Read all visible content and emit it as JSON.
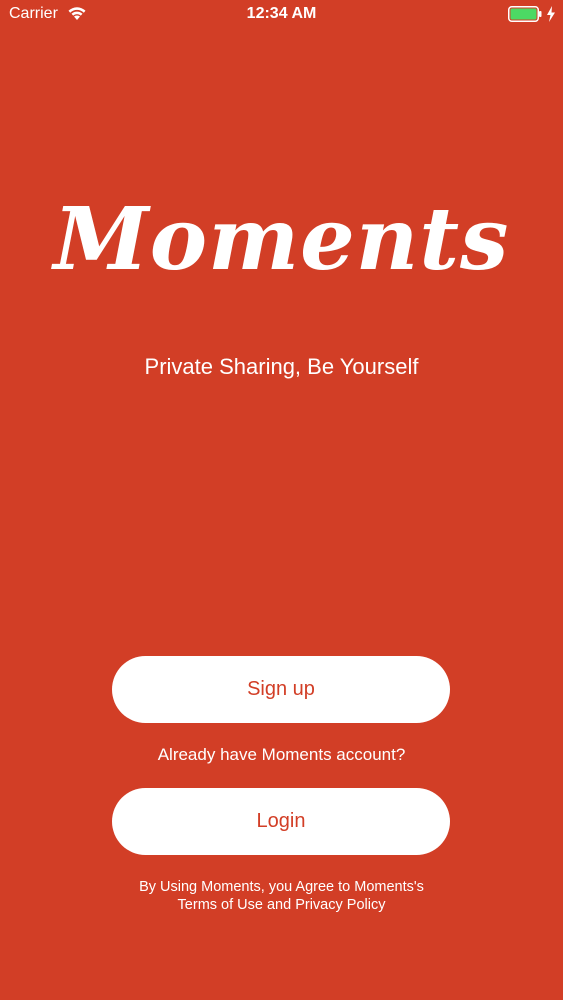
{
  "status_bar": {
    "carrier": "Carrier",
    "time": "12:34 AM",
    "icons": [
      "wifi-icon",
      "battery-icon",
      "bolt-icon"
    ]
  },
  "brand": {
    "logo_text": "Moments",
    "tagline": "Private Sharing, Be Yourself"
  },
  "actions": {
    "signup_label": "Sign up",
    "already_text": "Already have Moments account?",
    "login_label": "Login"
  },
  "legal": {
    "line1": "By Using Moments, you Agree to Moments's",
    "line2": "Terms of Use and Privacy Policy"
  },
  "colors": {
    "background": "#d23e26",
    "button_bg": "#ffffff",
    "button_text": "#d23e26",
    "battery_fill": "#4cd964"
  }
}
